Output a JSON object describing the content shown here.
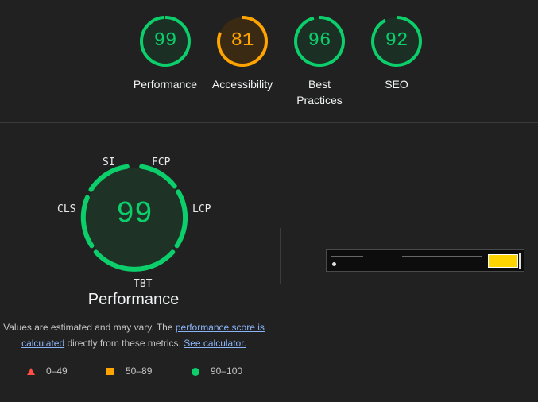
{
  "colors": {
    "pass": "#0cce6b",
    "average": "#ffa400",
    "fail": "#ff4e42",
    "link": "#8ab4f8"
  },
  "categories": [
    {
      "label": "Performance",
      "score": "99",
      "status": "pass"
    },
    {
      "label": "Accessibility",
      "score": "81",
      "status": "average"
    },
    {
      "label": "Best Practices",
      "score": "96",
      "status": "pass"
    },
    {
      "label": "SEO",
      "score": "92",
      "status": "pass"
    }
  ],
  "performance": {
    "score": "99",
    "title": "Performance",
    "metrics": [
      "SI",
      "FCP",
      "LCP",
      "TBT",
      "CLS"
    ]
  },
  "note": {
    "text1": "Values are estimated and may vary. The ",
    "link1": "performance score is calculated",
    "text2": " directly from these metrics. ",
    "link2": "See calculator."
  },
  "legend": [
    {
      "range": "0–49",
      "icon": "triangle-icon"
    },
    {
      "range": "50–89",
      "icon": "square-icon"
    },
    {
      "range": "90–100",
      "icon": "circle-icon"
    }
  ]
}
